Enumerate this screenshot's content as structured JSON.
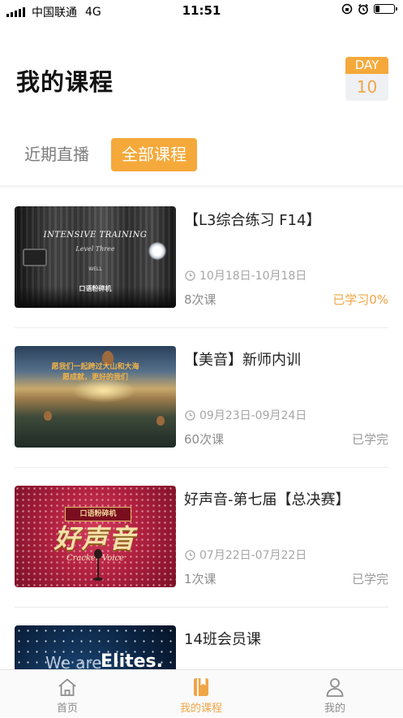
{
  "status_bar": {
    "carrier": "中国联通",
    "network": "4G",
    "time": "11:51"
  },
  "header": {
    "title": "我的课程",
    "day_label": "DAY",
    "day_number": "10"
  },
  "tabs": [
    {
      "label": "近期直播",
      "active": false
    },
    {
      "label": "全部课程",
      "active": true
    }
  ],
  "courses": [
    {
      "title": "【L3综合练习 F14】",
      "date_range": "10月18日-10月18日",
      "lesson_count": "8次课",
      "progress": "已学习0%",
      "thumbnail": {
        "line1": "INTENSIVE TRAINING",
        "line2": "Level Three",
        "line3": "WELL",
        "line4": "口语粉碎机"
      }
    },
    {
      "title": "【美音】新师内训",
      "date_range": "09月23日-09月24日",
      "lesson_count": "60次课",
      "progress": "已学完",
      "thumbnail": {
        "line1": "愿我们一起跨过大山和大海",
        "line2": "愿成就，更好的我们"
      }
    },
    {
      "title": "好声音-第七届【总决赛】",
      "date_range": "07月22日-07月22日",
      "lesson_count": "1次课",
      "progress": "已学完",
      "thumbnail": {
        "banner": "口语粉碎机",
        "big": "好声音",
        "sub": "Cracker Voice"
      }
    },
    {
      "title": "14班会员课",
      "date_range": "",
      "lesson_count": "",
      "progress": "",
      "thumbnail": {
        "word1": "We are",
        "word2": "Elites."
      }
    }
  ],
  "bottom_nav": [
    {
      "label": "首页",
      "icon": "home-icon",
      "active": false
    },
    {
      "label": "我的课程",
      "icon": "book-icon",
      "active": true
    },
    {
      "label": "我的",
      "icon": "person-icon",
      "active": false
    }
  ],
  "colors": {
    "accent": "#f5a93a",
    "text_primary": "#222222",
    "text_secondary": "#8c8c8c"
  }
}
